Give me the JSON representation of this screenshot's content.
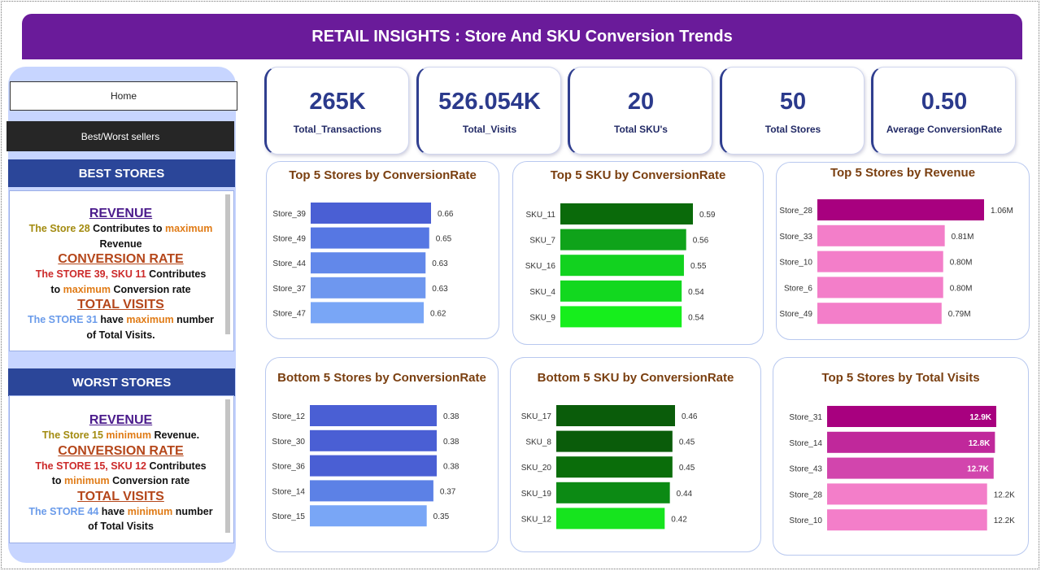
{
  "header": {
    "title": "RETAIL INSIGHTS : Store And SKU Conversion Trends"
  },
  "nav": {
    "home_label": "Home",
    "bestworst_label": "Best/Worst sellers"
  },
  "best": {
    "title": "BEST STORES",
    "revenue_heading": "REVENUE",
    "rev_a": "The Store 28",
    "rev_b": " Contributes to ",
    "rev_c": "maximum",
    "rev_d": "Revenue",
    "conv_heading": "CONVERSION RATE",
    "conv_a": "The STORE 39, SKU 11",
    "conv_b": "  Contributes",
    "conv_c": "to ",
    "conv_d": "maximum",
    "conv_e": " Conversion rate",
    "visits_heading": "TOTAL VISITS",
    "vis_a": "The STORE 31",
    "vis_b": " have ",
    "vis_c": "maximum",
    "vis_d": "  number",
    "vis_e": "of Total Visits."
  },
  "worst": {
    "title": "WORST STORES",
    "revenue_heading": "REVENUE",
    "rev_a": "The Store 15",
    "rev_b": "  minimum",
    "rev_c": " Revenue.",
    "conv_heading": "CONVERSION RATE",
    "conv_a": "The STORE 15, SKU 12",
    "conv_b": "  Contributes",
    "conv_c": "to ",
    "conv_d": "minimum",
    "conv_e": " Conversion rate",
    "visits_heading": "TOTAL VISITS",
    "vis_a": "The STORE 44",
    "vis_b": " have  ",
    "vis_c": "minimum",
    "vis_d": " number",
    "vis_e": "of Total Visits"
  },
  "kpis": [
    {
      "value": "265K",
      "label": "Total_Transactions"
    },
    {
      "value": "526.054K",
      "label": "Total_Visits"
    },
    {
      "value": "20",
      "label": "Total SKU's"
    },
    {
      "value": "50",
      "label": "Total Stores"
    },
    {
      "value": "0.50",
      "label": "Average ConversionRate"
    }
  ],
  "chart_data": [
    {
      "type": "bar",
      "title": "Top 5 Stores by ConversionRate",
      "categories": [
        "Store_39",
        "Store_49",
        "Store_44",
        "Store_37",
        "Store_47"
      ],
      "values": [
        0.66,
        0.65,
        0.63,
        0.63,
        0.62
      ],
      "labels": [
        "0.66",
        "0.65",
        "0.63",
        "0.63",
        "0.62"
      ],
      "colors": [
        "#4a5fd4",
        "#5677e3",
        "#6288ea",
        "#6e97ef",
        "#79a6f6"
      ]
    },
    {
      "type": "bar",
      "title": "Top 5 SKU by ConversionRate",
      "categories": [
        "SKU_11",
        "SKU_7",
        "SKU_16",
        "SKU_4",
        "SKU_9"
      ],
      "values": [
        0.59,
        0.56,
        0.55,
        0.54,
        0.54
      ],
      "labels": [
        "0.59",
        "0.56",
        "0.55",
        "0.54",
        "0.54"
      ],
      "colors": [
        "#0a6a0a",
        "#0fa31a",
        "#12d21f",
        "#12d81f",
        "#16ee1c"
      ]
    },
    {
      "type": "bar",
      "title": "Top 5 Stores by Revenue",
      "categories": [
        "Store_28",
        "Store_33",
        "Store_10",
        "Store_6",
        "Store_49"
      ],
      "values": [
        1.06,
        0.81,
        0.8,
        0.8,
        0.79
      ],
      "labels": [
        "1.06M",
        "0.81M",
        "0.80M",
        "0.80M",
        "0.79M"
      ],
      "colors": [
        "#a8007f",
        "#f37ec9",
        "#f37ec9",
        "#f37ec9",
        "#f37ec9"
      ]
    },
    {
      "type": "bar",
      "title": "Bottom 5 Stores by ConversionRate",
      "categories": [
        "Store_12",
        "Store_30",
        "Store_36",
        "Store_14",
        "Store_15"
      ],
      "values": [
        0.38,
        0.38,
        0.38,
        0.37,
        0.35
      ],
      "labels": [
        "0.38",
        "0.38",
        "0.38",
        "0.37",
        "0.35"
      ],
      "colors": [
        "#4a5fd4",
        "#4a5fd4",
        "#4a5fd4",
        "#5c81e6",
        "#79a6f6"
      ]
    },
    {
      "type": "bar",
      "title": "Bottom 5 SKU by ConversionRate",
      "categories": [
        "SKU_17",
        "SKU_8",
        "SKU_20",
        "SKU_19",
        "SKU_12"
      ],
      "values": [
        0.46,
        0.45,
        0.45,
        0.44,
        0.42
      ],
      "labels": [
        "0.46",
        "0.45",
        "0.45",
        "0.44",
        "0.42"
      ],
      "colors": [
        "#0a5c0a",
        "#0a5c0a",
        "#0a6d0a",
        "#0c8a14",
        "#16e41e"
      ]
    },
    {
      "type": "bar",
      "title": "Top 5 Stores by Total Visits",
      "categories": [
        "Store_31",
        "Store_14",
        "Store_43",
        "Store_28",
        "Store_10"
      ],
      "values": [
        12.9,
        12.8,
        12.7,
        12.2,
        12.2
      ],
      "labels": [
        "12.9K",
        "12.8K",
        "12.7K",
        "12.2K",
        "12.2K"
      ],
      "colors": [
        "#a8007f",
        "#c0289b",
        "#d245ad",
        "#f37ec9",
        "#f37ec9"
      ]
    }
  ]
}
